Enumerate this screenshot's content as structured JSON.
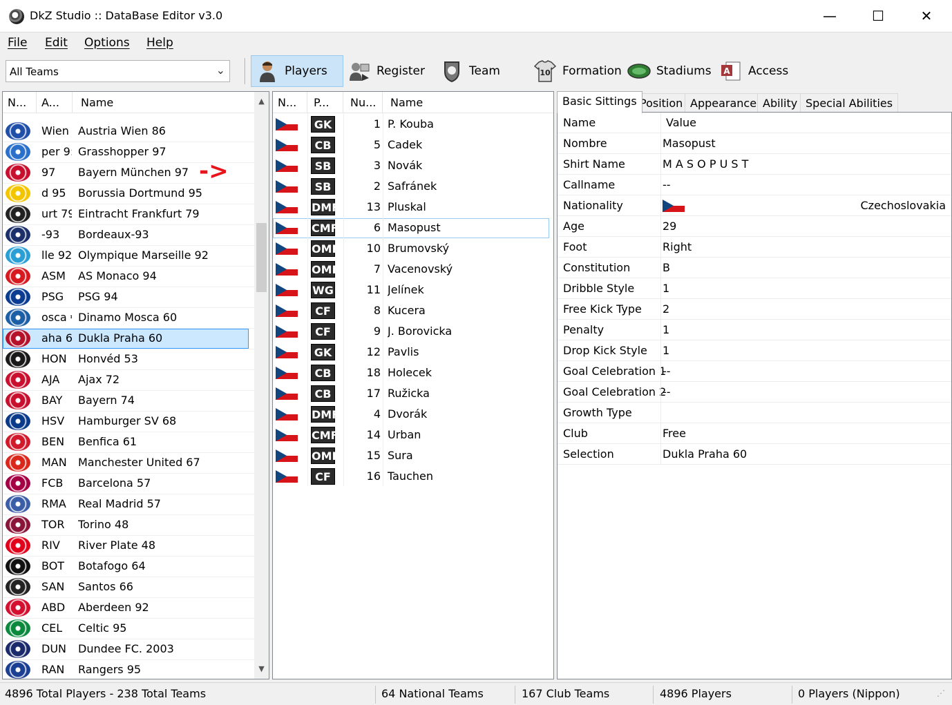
{
  "window": {
    "title": "DkZ Studio :: DataBase Editor v3.0",
    "min_glyph": "—",
    "max_glyph": "☐",
    "close_glyph": "✕"
  },
  "menu": [
    {
      "label": "File"
    },
    {
      "label": "Edit"
    },
    {
      "label": "Options"
    },
    {
      "label": "Help"
    }
  ],
  "toolbar": {
    "team_filter": "All Teams",
    "buttons": [
      {
        "label": "Players",
        "icon": "player-icon",
        "active": true
      },
      {
        "label": "Register",
        "icon": "register-icon"
      },
      {
        "label": "Team",
        "icon": "team-shield-icon"
      },
      {
        "label": "Formation",
        "icon": "formation-shirt-icon"
      },
      {
        "label": "Stadiums",
        "icon": "stadium-icon"
      },
      {
        "label": "Access",
        "icon": "access-icon"
      }
    ]
  },
  "teams": {
    "columns": [
      "N...",
      "A...",
      "Name"
    ],
    "rows": [
      {
        "abbr": "Wien",
        "name": "Austria Wien 86",
        "crest": "#1f4fa8"
      },
      {
        "abbr": "per 9:",
        "name": "Grasshopper 97",
        "crest": "#2a6fc9"
      },
      {
        "abbr": "97",
        "name": "Bayern München 97",
        "crest": "#c8102e"
      },
      {
        "abbr": "d 95",
        "name": "Borussia Dortmund 95",
        "crest": "#f2c500"
      },
      {
        "abbr": "urt 79",
        "name": "Eintracht Frankfurt 79",
        "crest": "#222222"
      },
      {
        "abbr": "-93",
        "name": "Bordeaux-93",
        "crest": "#1b2f6b"
      },
      {
        "abbr": "lle 92",
        "name": "Olympique Marseille 92",
        "crest": "#2a9fd6"
      },
      {
        "abbr": "ASM",
        "name": "AS Monaco 94",
        "crest": "#d71920"
      },
      {
        "abbr": "PSG",
        "name": "PSG 94",
        "crest": "#0a3d91"
      },
      {
        "abbr": "osca €",
        "name": "Dinamo Mosca 60",
        "crest": "#1d5fa6"
      },
      {
        "abbr": "aha 6",
        "name": "Dukla Praha 60",
        "crest": "#b5122a",
        "selected": true
      },
      {
        "abbr": "HON",
        "name": "Honvéd 53",
        "crest": "#1a1a1a"
      },
      {
        "abbr": "AJA",
        "name": "Ajax 72",
        "crest": "#c9102e"
      },
      {
        "abbr": "BAY",
        "name": "Bayern 74",
        "crest": "#c8102e"
      },
      {
        "abbr": "HSV",
        "name": "Hamburger SV 68",
        "crest": "#0a3a8a"
      },
      {
        "abbr": "BEN",
        "name": "Benfica 61",
        "crest": "#d11b2c"
      },
      {
        "abbr": "MAN",
        "name": "Manchester United 67",
        "crest": "#da291c"
      },
      {
        "abbr": "FCB",
        "name": "Barcelona 57",
        "crest": "#a50044"
      },
      {
        "abbr": "RMA",
        "name": "Real Madrid 57",
        "crest": "#3a5ea8"
      },
      {
        "abbr": "TOR",
        "name": "Torino 48",
        "crest": "#8a1538"
      },
      {
        "abbr": "RIV",
        "name": "River Plate 48",
        "crest": "#e2001a"
      },
      {
        "abbr": "BOT",
        "name": "Botafogo 64",
        "crest": "#111111"
      },
      {
        "abbr": "SAN",
        "name": "Santos 66",
        "crest": "#222222"
      },
      {
        "abbr": "ABD",
        "name": "Aberdeen 92",
        "crest": "#d4102f"
      },
      {
        "abbr": "CEL",
        "name": "Celtic 95",
        "crest": "#0b8a3e"
      },
      {
        "abbr": "DUN",
        "name": "Dundee FC. 2003",
        "crest": "#1b2a6b"
      },
      {
        "abbr": "RAN",
        "name": "Rangers 95",
        "crest": "#1b3f93"
      }
    ],
    "annotation": "->"
  },
  "players": {
    "columns": [
      "N...",
      "P...",
      "Nu...",
      "Name"
    ],
    "rows": [
      {
        "pos": "GK",
        "num": "1",
        "name": "P. Kouba"
      },
      {
        "pos": "CB",
        "num": "5",
        "name": "Cadek"
      },
      {
        "pos": "SB",
        "num": "3",
        "name": "Novák"
      },
      {
        "pos": "SB",
        "num": "2",
        "name": "Safránek"
      },
      {
        "pos": "DMF",
        "num": "13",
        "name": "Pluskal"
      },
      {
        "pos": "CMF",
        "num": "6",
        "name": "Masopust",
        "selected": true
      },
      {
        "pos": "OMF",
        "num": "10",
        "name": "Brumovský"
      },
      {
        "pos": "OMF",
        "num": "7",
        "name": "Vacenovský"
      },
      {
        "pos": "WG",
        "num": "11",
        "name": "Jelínek"
      },
      {
        "pos": "CF",
        "num": "8",
        "name": "Kucera"
      },
      {
        "pos": "CF",
        "num": "9",
        "name": "J. Borovicka"
      },
      {
        "pos": "GK",
        "num": "12",
        "name": "Pavlis"
      },
      {
        "pos": "CB",
        "num": "18",
        "name": "Holecek"
      },
      {
        "pos": "CB",
        "num": "17",
        "name": "Ružicka"
      },
      {
        "pos": "DMF",
        "num": "4",
        "name": "Dvorák"
      },
      {
        "pos": "CMF",
        "num": "14",
        "name": "Urban"
      },
      {
        "pos": "OMF",
        "num": "15",
        "name": "Sura"
      },
      {
        "pos": "CF",
        "num": "16",
        "name": "Tauchen"
      }
    ]
  },
  "details": {
    "tabs": [
      "Basic Sittings",
      "Position",
      "Appearance",
      "Ability",
      "Special Abilities"
    ],
    "header": {
      "key": "Name",
      "value": "Value"
    },
    "rows": [
      {
        "key": "Nombre",
        "value": "Masopust"
      },
      {
        "key": "Shirt Name",
        "value": "M A S O P U S T"
      },
      {
        "key": "Callname",
        "value": "--"
      },
      {
        "key": "Nationality",
        "value": "Czechoslovakia",
        "flag": true
      },
      {
        "key": "Age",
        "value": "29"
      },
      {
        "key": "Foot",
        "value": "Right"
      },
      {
        "key": "Constitution",
        "value": "B"
      },
      {
        "key": "Dribble Style",
        "value": "1"
      },
      {
        "key": "Free Kick Type",
        "value": "2"
      },
      {
        "key": "Penalty",
        "value": "1"
      },
      {
        "key": "Drop Kick Style",
        "value": "1"
      },
      {
        "key": "Goal Celebration 1",
        "value": "--"
      },
      {
        "key": "Goal Celebration 2",
        "value": "--"
      },
      {
        "key": "Growth Type",
        "value": ""
      },
      {
        "key": "Club",
        "value": "Free"
      },
      {
        "key": "Selection",
        "value": "Dukla Praha 60"
      }
    ]
  },
  "status": {
    "totals": "4896 Total Players  -  238 Total Teams",
    "national": "64 National Teams",
    "club": "167 Club Teams",
    "players": "4896 Players",
    "nippon": "0 Players (Nippon)"
  }
}
